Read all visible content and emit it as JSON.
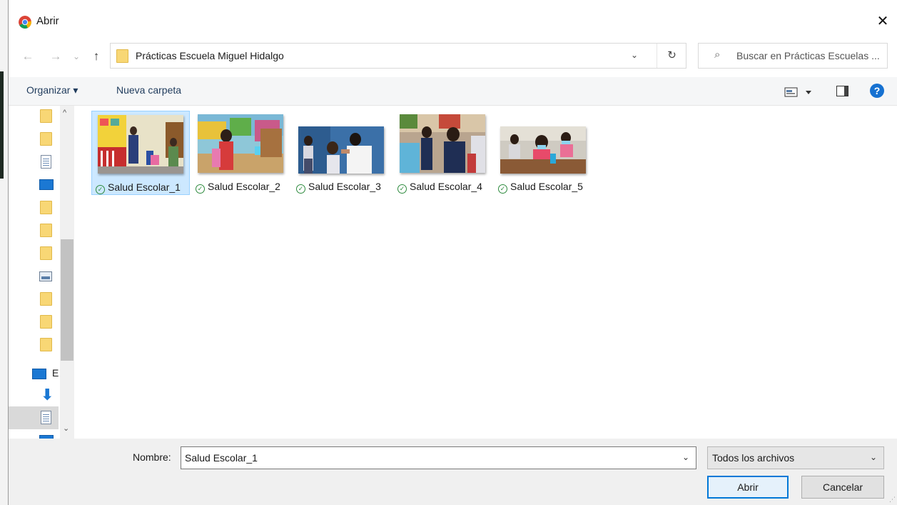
{
  "window": {
    "title": "Abrir",
    "close_glyph": "✕",
    "app_icon": "chrome-icon"
  },
  "address_bar": {
    "back_glyph": "←",
    "forward_glyph": "→",
    "recent_glyph": "⌄",
    "up_glyph": "↑",
    "path": "Prácticas Escuela Miguel Hidalgo",
    "dropdown_glyph": "⌄",
    "refresh_glyph": "↻"
  },
  "search": {
    "icon_glyph": "⌕",
    "placeholder": "Buscar en Prácticas Escuelas ..."
  },
  "toolbar": {
    "organize_label": "Organizar ▾",
    "new_folder_label": "Nueva carpeta",
    "help_glyph": "?"
  },
  "nav_pane": {
    "pc_label": "E",
    "scroll_up_glyph": "^",
    "scroll_down_glyph": "⌄"
  },
  "files": [
    {
      "name": "Salud Escolar_1",
      "selected": true,
      "sync_status": "available"
    },
    {
      "name": "Salud Escolar_2",
      "selected": false,
      "sync_status": "available"
    },
    {
      "name": "Salud Escolar_3",
      "selected": false,
      "sync_status": "available"
    },
    {
      "name": "Salud Escolar_4",
      "selected": false,
      "sync_status": "available"
    },
    {
      "name": "Salud Escolar_5",
      "selected": false,
      "sync_status": "available"
    }
  ],
  "check_glyph": "✓",
  "bottom": {
    "name_label": "Nombre:",
    "name_value": "Salud Escolar_1",
    "name_dropdown_glyph": "⌄",
    "file_type": "Todos los archivos",
    "type_dropdown_glyph": "⌄",
    "open_button": "Abrir",
    "cancel_button": "Cancelar"
  },
  "colors": {
    "accent": "#0078d7",
    "selection_bg": "#cce8ff",
    "help_icon": "#1671d1",
    "sync_check": "#2e8b3e"
  }
}
